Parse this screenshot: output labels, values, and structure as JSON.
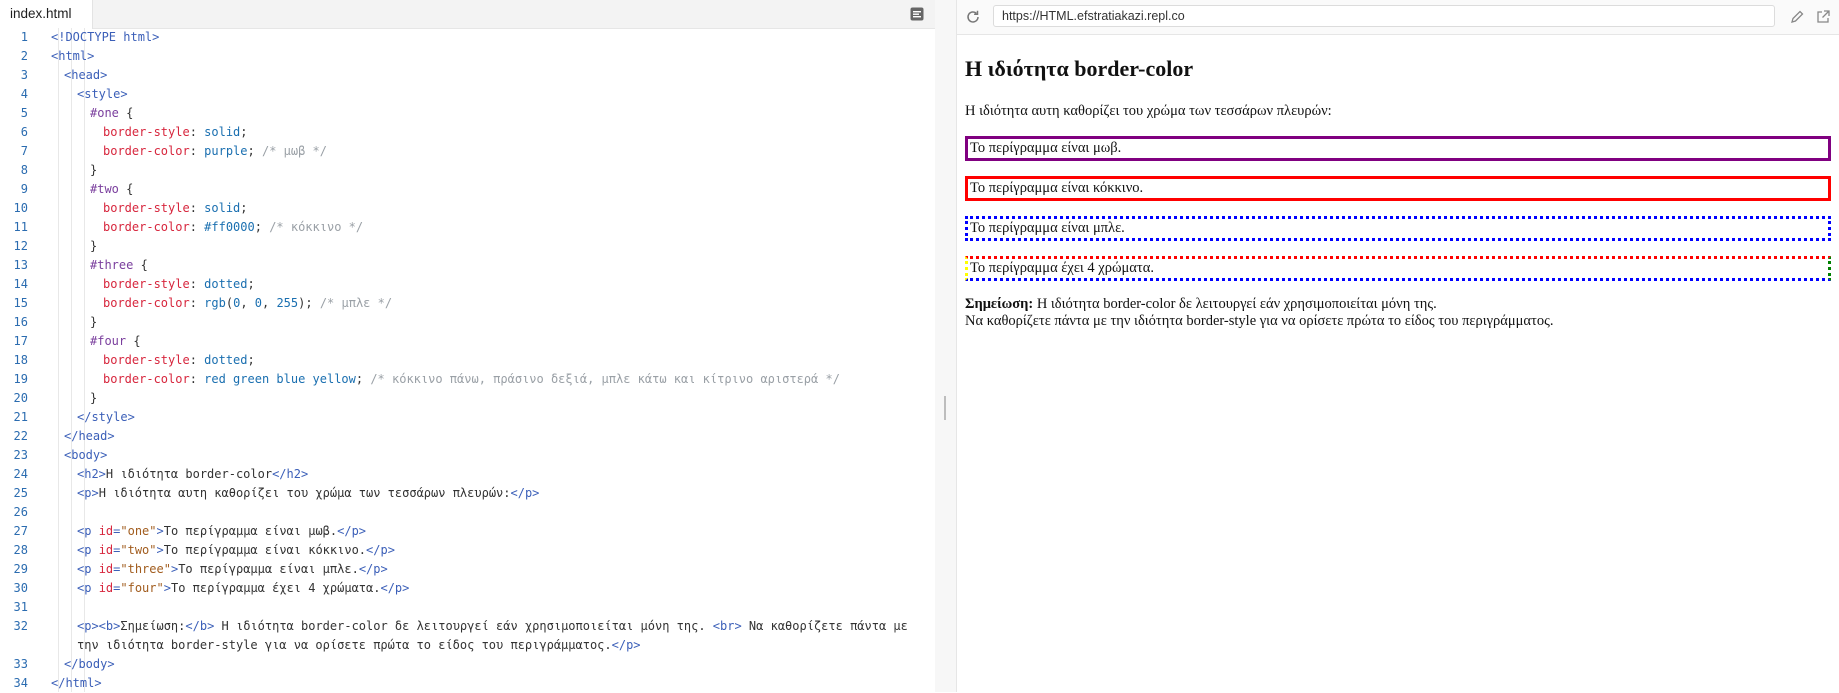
{
  "editor": {
    "tab_label": "index.html",
    "lines": [
      {
        "n": "1",
        "parts": [
          [
            "tg",
            "<!DOCTYPE "
          ],
          [
            "tg",
            "html"
          ],
          [
            "tg",
            ">"
          ]
        ],
        "indent": 0
      },
      {
        "n": "2",
        "parts": [
          [
            "tg",
            "<html>"
          ]
        ],
        "indent": 0
      },
      {
        "n": "3",
        "parts": [
          [
            "tg",
            "<head>"
          ]
        ],
        "indent": 1
      },
      {
        "n": "4",
        "parts": [
          [
            "tg",
            "<style>"
          ]
        ],
        "indent": 2
      },
      {
        "n": "5",
        "parts": [
          [
            "sl",
            "#one"
          ],
          [
            "",
            " {"
          ]
        ],
        "indent": 3
      },
      {
        "n": "6",
        "parts": [
          [
            "pr",
            "border-style"
          ],
          [
            "",
            ": "
          ],
          [
            "vl",
            "solid"
          ],
          [
            "",
            ";"
          ]
        ],
        "indent": 4
      },
      {
        "n": "7",
        "parts": [
          [
            "pr",
            "border-color"
          ],
          [
            "",
            ": "
          ],
          [
            "vl",
            "purple"
          ],
          [
            "",
            "; "
          ],
          [
            "cm",
            "/* μωβ */"
          ]
        ],
        "indent": 4
      },
      {
        "n": "8",
        "parts": [
          [
            "",
            "}"
          ]
        ],
        "indent": 3
      },
      {
        "n": "9",
        "parts": [
          [
            "sl",
            "#two"
          ],
          [
            "",
            " {"
          ]
        ],
        "indent": 3
      },
      {
        "n": "10",
        "parts": [
          [
            "pr",
            "border-style"
          ],
          [
            "",
            ": "
          ],
          [
            "vl",
            "solid"
          ],
          [
            "",
            ";"
          ]
        ],
        "indent": 4
      },
      {
        "n": "11",
        "parts": [
          [
            "pr",
            "border-color"
          ],
          [
            "",
            ": "
          ],
          [
            "vl",
            "#ff0000"
          ],
          [
            "",
            "; "
          ],
          [
            "cm",
            "/* κόκκινο */"
          ]
        ],
        "indent": 4
      },
      {
        "n": "12",
        "parts": [
          [
            "",
            "}"
          ]
        ],
        "indent": 3
      },
      {
        "n": "13",
        "parts": [
          [
            "sl",
            "#three"
          ],
          [
            "",
            " {"
          ]
        ],
        "indent": 3
      },
      {
        "n": "14",
        "parts": [
          [
            "pr",
            "border-style"
          ],
          [
            "",
            ": "
          ],
          [
            "vl",
            "dotted"
          ],
          [
            "",
            ";"
          ]
        ],
        "indent": 4
      },
      {
        "n": "15",
        "parts": [
          [
            "pr",
            "border-color"
          ],
          [
            "",
            ": "
          ],
          [
            "vl",
            "rgb"
          ],
          [
            "",
            "("
          ],
          [
            "nm",
            "0"
          ],
          [
            "",
            ", "
          ],
          [
            "nm",
            "0"
          ],
          [
            "",
            ", "
          ],
          [
            "nm",
            "255"
          ],
          [
            "",
            "); "
          ],
          [
            "cm",
            "/* μπλε */"
          ]
        ],
        "indent": 4
      },
      {
        "n": "16",
        "parts": [
          [
            "",
            "}"
          ]
        ],
        "indent": 3
      },
      {
        "n": "17",
        "parts": [
          [
            "sl",
            "#four"
          ],
          [
            "",
            " {"
          ]
        ],
        "indent": 3
      },
      {
        "n": "18",
        "parts": [
          [
            "pr",
            "border-style"
          ],
          [
            "",
            ": "
          ],
          [
            "vl",
            "dotted"
          ],
          [
            "",
            ";"
          ]
        ],
        "indent": 4
      },
      {
        "n": "19",
        "parts": [
          [
            "pr",
            "border-color"
          ],
          [
            "",
            ": "
          ],
          [
            "vl",
            "red green blue yellow"
          ],
          [
            "",
            "; "
          ],
          [
            "cm",
            "/* κόκκινο πάνω, πράσινο δεξιά, μπλε κάτω και κίτρινο αριστερά */"
          ]
        ],
        "indent": 4
      },
      {
        "n": "20",
        "parts": [
          [
            "",
            "}"
          ]
        ],
        "indent": 3
      },
      {
        "n": "21",
        "parts": [
          [
            "tg",
            "</style>"
          ]
        ],
        "indent": 2
      },
      {
        "n": "22",
        "parts": [
          [
            "tg",
            "</head>"
          ]
        ],
        "indent": 1
      },
      {
        "n": "23",
        "parts": [
          [
            "tg",
            "<body>"
          ]
        ],
        "indent": 1
      },
      {
        "n": "24",
        "parts": [
          [
            "tg",
            "<h2>"
          ],
          [
            "",
            "Η ιδιότητα border-color"
          ],
          [
            "tg",
            "</h2>"
          ]
        ],
        "indent": 2
      },
      {
        "n": "25",
        "parts": [
          [
            "tg",
            "<p>"
          ],
          [
            "",
            "Η ιδιότητα αυτη καθορίζει του χρώμα των τεσσάρων πλευρών:"
          ],
          [
            "tg",
            "</p>"
          ]
        ],
        "indent": 2
      },
      {
        "n": "26",
        "parts": [],
        "indent": 2
      },
      {
        "n": "27",
        "parts": [
          [
            "tg",
            "<p "
          ],
          [
            "pr",
            "id"
          ],
          [
            "tg",
            "="
          ],
          [
            "st",
            "\"one\""
          ],
          [
            "tg",
            ">"
          ],
          [
            "",
            "Το περίγραμμα είναι μωβ."
          ],
          [
            "tg",
            "</p>"
          ]
        ],
        "indent": 2
      },
      {
        "n": "28",
        "parts": [
          [
            "tg",
            "<p "
          ],
          [
            "pr",
            "id"
          ],
          [
            "tg",
            "="
          ],
          [
            "st",
            "\"two\""
          ],
          [
            "tg",
            ">"
          ],
          [
            "",
            "Το περίγραμμα είναι κόκκινο."
          ],
          [
            "tg",
            "</p>"
          ]
        ],
        "indent": 2
      },
      {
        "n": "29",
        "parts": [
          [
            "tg",
            "<p "
          ],
          [
            "pr",
            "id"
          ],
          [
            "tg",
            "="
          ],
          [
            "st",
            "\"three\""
          ],
          [
            "tg",
            ">"
          ],
          [
            "",
            "Το περίγραμμα είναι μπλε."
          ],
          [
            "tg",
            "</p>"
          ]
        ],
        "indent": 2
      },
      {
        "n": "30",
        "parts": [
          [
            "tg",
            "<p "
          ],
          [
            "pr",
            "id"
          ],
          [
            "tg",
            "="
          ],
          [
            "st",
            "\"four\""
          ],
          [
            "tg",
            ">"
          ],
          [
            "",
            "Το περίγραμμα έχει 4 χρώματα."
          ],
          [
            "tg",
            "</p>"
          ]
        ],
        "indent": 2
      },
      {
        "n": "31",
        "parts": [],
        "indent": 2
      },
      {
        "n": "32",
        "parts": [
          [
            "tg",
            "<p><b>"
          ],
          [
            "",
            "Σημείωση:"
          ],
          [
            "tg",
            "</b>"
          ],
          [
            "",
            " Η ιδιότητα border-color δε λειτουργεί εάν χρησιμοποιείται μόνη της. "
          ],
          [
            "tg",
            "<br>"
          ],
          [
            "",
            " Να καθορίζετε πάντα με την ιδιότητα border-style για να ορίσετε πρώτα το είδος του περιγράμματος."
          ],
          [
            "tg",
            "</p>"
          ]
        ],
        "indent": 2,
        "tall": true
      },
      {
        "n": "33",
        "parts": [
          [
            "tg",
            "</body>"
          ]
        ],
        "indent": 1
      },
      {
        "n": "34",
        "parts": [
          [
            "tg",
            "</html>"
          ]
        ],
        "indent": 0
      }
    ]
  },
  "browser": {
    "url": "https://HTML.efstratiakazi.repl.co",
    "page": {
      "heading": "Η ιδιότητα border-color",
      "intro": "Η ιδιότητα αυτη καθορίζει του χρώμα των τεσσάρων πλευρών:",
      "one": "Το περίγραμμα είναι μωβ.",
      "two": "Το περίγραμμα είναι κόκκινο.",
      "three": "Το περίγραμμα είναι μπλε.",
      "four": "Το περίγραμμα έχει 4 χρώματα.",
      "note_bold": "Σημείωση:",
      "note_line1": " Η ιδιότητα border-color δε λειτουργεί εάν χρησιμοποιείται μόνη της.",
      "note_line2": "Να καθορίζετε πάντα με την ιδιότητα border-style για να ορίσετε πρώτα το είδος του περιγράμματος."
    }
  },
  "icons": {
    "settings": "format-icon",
    "reload": "reload-icon",
    "edit": "pencil-icon",
    "open": "open-in-new-tab-icon"
  },
  "colors": {
    "purple": "#800080",
    "red": "#ff0000",
    "blue": "#0000ff",
    "green": "#008000",
    "yellow": "#ffff00"
  }
}
